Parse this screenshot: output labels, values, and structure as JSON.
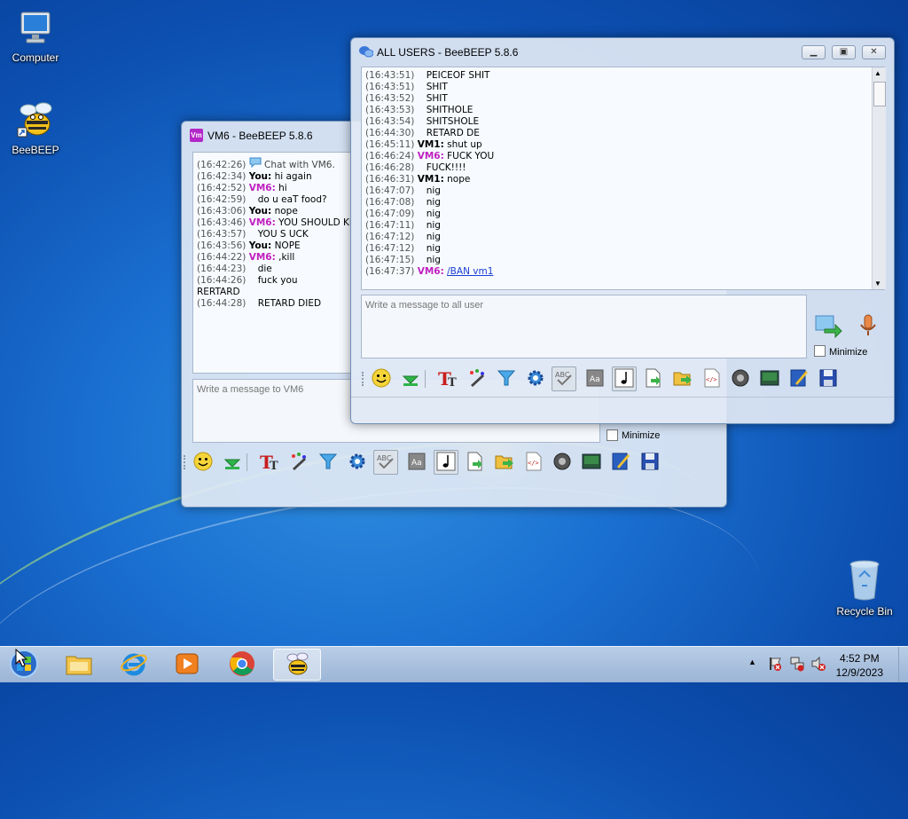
{
  "desktop": {
    "icons": [
      {
        "label": "Computer",
        "icon": "computer-icon"
      },
      {
        "label": "BeeBEEP",
        "icon": "beebeep-icon"
      },
      {
        "label": "Recycle Bin",
        "icon": "recycle-bin-icon"
      }
    ]
  },
  "vm6_window": {
    "title": "VM6 - BeeBEEP 5.8.6",
    "app_badge": "Vm",
    "messages": [
      {
        "time": "(16:42:26)",
        "sender": "",
        "text": "Chat with VM6.",
        "kind": "system"
      },
      {
        "time": "(16:42:34)",
        "sender": "You:",
        "text": "hi again",
        "kind": "you"
      },
      {
        "time": "(16:42:52)",
        "sender": "VM6:",
        "text": "hi",
        "kind": "vm6"
      },
      {
        "time": "(16:42:59)",
        "sender": "",
        "text": "do u eaT food?",
        "kind": "cont"
      },
      {
        "time": "(16:43:06)",
        "sender": "You:",
        "text": "nope",
        "kind": "you"
      },
      {
        "time": "(16:43:46)",
        "sender": "VM6:",
        "text": "YOU SHOULD KILL",
        "kind": "vm6"
      },
      {
        "time": "(16:43:57)",
        "sender": "",
        "text": "YOU S UCK",
        "kind": "cont"
      },
      {
        "time": "(16:43:56)",
        "sender": "You:",
        "text": "NOPE",
        "kind": "you"
      },
      {
        "time": "(16:44:22)",
        "sender": "VM6:",
        "text": ",kill",
        "kind": "vm6"
      },
      {
        "time": "(16:44:23)",
        "sender": "",
        "text": "die",
        "kind": "cont"
      },
      {
        "time": "(16:44:26)",
        "sender": "",
        "text": "fuck you",
        "kind": "cont"
      },
      {
        "time": "",
        "sender": "",
        "text": "RERTARD",
        "kind": "plain"
      },
      {
        "time": "(16:44:28)",
        "sender": "",
        "text": "RETARD DIED",
        "kind": "cont"
      }
    ],
    "input_placeholder": "Write a message to VM6",
    "minimize_label": "Minimize"
  },
  "all_users_window": {
    "title": "ALL USERS - BeeBEEP 5.8.6",
    "messages": [
      {
        "time": "(16:43:51)",
        "sender": "",
        "text": "PEICEOF SHIT",
        "kind": "cont"
      },
      {
        "time": "(16:43:51)",
        "sender": "",
        "text": "SHIT",
        "kind": "cont"
      },
      {
        "time": "(16:43:52)",
        "sender": "",
        "text": "SHIT",
        "kind": "cont"
      },
      {
        "time": "(16:43:53)",
        "sender": "",
        "text": "SHITHOLE",
        "kind": "cont"
      },
      {
        "time": "(16:43:54)",
        "sender": "",
        "text": "SHITSHOLE",
        "kind": "cont"
      },
      {
        "time": "(16:44:30)",
        "sender": "",
        "text": "RETARD DE",
        "kind": "cont"
      },
      {
        "time": "(16:45:11)",
        "sender": "VM1:",
        "text": "shut up",
        "kind": "vm1"
      },
      {
        "time": "(16:46:24)",
        "sender": "VM6:",
        "text": "FUCK YOU",
        "kind": "vm6"
      },
      {
        "time": "(16:46:28)",
        "sender": "",
        "text": "FUCK!!!!",
        "kind": "cont"
      },
      {
        "time": "(16:46:31)",
        "sender": "VM1:",
        "text": "nope",
        "kind": "vm1"
      },
      {
        "time": "(16:47:07)",
        "sender": "",
        "text": "nig",
        "kind": "cont"
      },
      {
        "time": "(16:47:08)",
        "sender": "",
        "text": "nig",
        "kind": "cont"
      },
      {
        "time": "(16:47:09)",
        "sender": "",
        "text": "nig",
        "kind": "cont"
      },
      {
        "time": "(16:47:11)",
        "sender": "",
        "text": "nig",
        "kind": "cont"
      },
      {
        "time": "(16:47:12)",
        "sender": "",
        "text": "nig",
        "kind": "cont"
      },
      {
        "time": "(16:47:12)",
        "sender": "",
        "text": "nig",
        "kind": "cont"
      },
      {
        "time": "(16:47:15)",
        "sender": "",
        "text": "nig",
        "kind": "cont"
      },
      {
        "time": "(16:47:37)",
        "sender": "VM6:",
        "text": "/BAN vm1",
        "kind": "vm6link"
      }
    ],
    "input_placeholder": "Write a message to all user",
    "minimize_label": "Minimize"
  },
  "toolbar_icons": [
    "emoticon-icon",
    "download-icon",
    "font-icon",
    "color-pen-icon",
    "filter-icon",
    "settings-gear-icon",
    "spellcheck-icon",
    "text-style-icon",
    "music-note-icon",
    "send-file-icon",
    "send-folder-icon",
    "html-code-icon",
    "screenshot-icon",
    "video-chat-icon",
    "edit-note-icon",
    "save-icon"
  ],
  "taskbar": {
    "apps": [
      "start-orb-icon",
      "file-explorer-icon",
      "internet-explorer-icon",
      "media-player-icon",
      "chrome-icon",
      "beebeep-icon"
    ],
    "time": "4:52 PM",
    "date": "12/9/2023"
  },
  "colors": {
    "vm6": "#c020c0",
    "link": "#1a3dd0",
    "window_border": "#6e8fb8"
  }
}
